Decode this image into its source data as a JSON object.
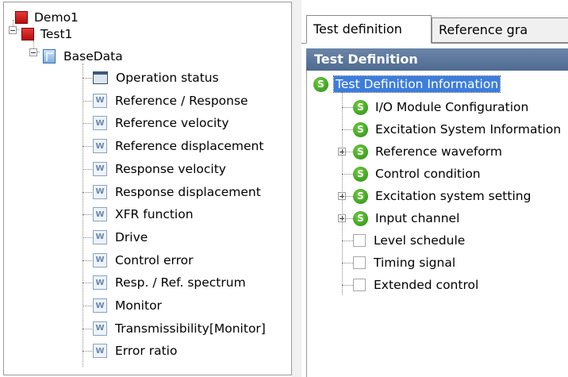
{
  "left_tree": {
    "root": {
      "label": "Demo1",
      "icon": "project-icon"
    },
    "test": {
      "label": "Test1",
      "icon": "test-icon"
    },
    "basedata": {
      "label": "BaseData",
      "icon": "data-folder-icon"
    },
    "items": [
      {
        "label": "Operation status",
        "icon": "window-icon"
      },
      {
        "label": "Reference / Response",
        "icon": "graph-icon"
      },
      {
        "label": "Reference velocity",
        "icon": "graph-icon"
      },
      {
        "label": "Reference displacement",
        "icon": "graph-icon"
      },
      {
        "label": "Response velocity",
        "icon": "graph-icon"
      },
      {
        "label": "Response displacement",
        "icon": "graph-icon"
      },
      {
        "label": "XFR function",
        "icon": "graph-icon"
      },
      {
        "label": "Drive",
        "icon": "graph-icon"
      },
      {
        "label": "Control error",
        "icon": "graph-icon"
      },
      {
        "label": "Resp. / Ref. spectrum",
        "icon": "graph-icon"
      },
      {
        "label": "Monitor",
        "icon": "graph-icon"
      },
      {
        "label": "Transmissibility[Monitor]",
        "icon": "graph-icon"
      },
      {
        "label": "Error ratio",
        "icon": "graph-icon"
      }
    ]
  },
  "tabs": [
    {
      "label": "Test definition",
      "active": true
    },
    {
      "label": "Reference gra",
      "active": false
    }
  ],
  "section_title": "Test Definition",
  "right_tree": {
    "root": {
      "label": "Test Definition Information",
      "selected": true
    },
    "items": [
      {
        "label": "I/O Module Configuration",
        "icon": "s-icon",
        "expandable": false
      },
      {
        "label": "Excitation System Information",
        "icon": "s-icon",
        "expandable": false
      },
      {
        "label": "Reference waveform",
        "icon": "s-icon",
        "expandable": true
      },
      {
        "label": "Control condition",
        "icon": "s-icon",
        "expandable": false
      },
      {
        "label": "Excitation system setting",
        "icon": "s-icon",
        "expandable": true
      },
      {
        "label": "Input channel",
        "icon": "s-icon",
        "expandable": true
      },
      {
        "label": "Level schedule",
        "icon": "box-icon",
        "expandable": false
      },
      {
        "label": "Timing signal",
        "icon": "box-icon",
        "expandable": false
      },
      {
        "label": "Extended control",
        "icon": "box-icon",
        "expandable": false
      }
    ]
  },
  "icon_glyphs": {
    "s": "S",
    "graph": "W"
  },
  "colors": {
    "section_bar": "#5a769c",
    "selection": "#3d7ddc",
    "status_green": "#3aa02a",
    "project_red": "#c81818"
  }
}
